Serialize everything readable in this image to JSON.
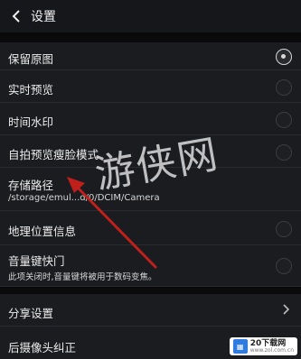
{
  "header": {
    "title": "设置"
  },
  "settings": {
    "keep_original": {
      "label": "保留原图",
      "enabled": true
    },
    "realtime_preview": {
      "label": "实时预览",
      "enabled": false
    },
    "time_watermark": {
      "label": "时间水印",
      "enabled": false
    },
    "selfie_preview_beauty": {
      "label": "自拍预览瘦脸模式",
      "enabled": false
    },
    "storage_path": {
      "label": "存储路径",
      "value": "/storage/emul...d/0/DCIM/Camera"
    },
    "location_info": {
      "label": "地理位置信息",
      "enabled": false
    },
    "volume_shutter": {
      "label": "音量键快门",
      "description": "此项关闭时,音量键将被用于数码变焦。",
      "enabled": false
    },
    "share_settings": {
      "label": "分享设置"
    },
    "rear_camera_correction": {
      "label": "后摄像头纠正"
    }
  },
  "watermark": {
    "text": "游侠网"
  },
  "brand": {
    "name": "20下载网",
    "url": "www.zol.com.cn"
  },
  "colors": {
    "background": "#121316",
    "row": "#1b1c20",
    "accent_arrow": "#c0201c"
  }
}
